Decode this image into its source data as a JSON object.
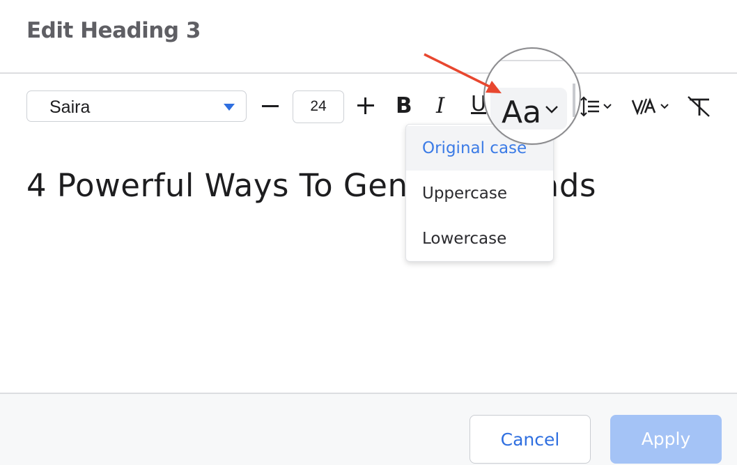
{
  "dialog": {
    "title": "Edit Heading 3"
  },
  "toolbar": {
    "font_family": "Saira",
    "font_size": "24",
    "bold_label": "B",
    "italic_label": "I",
    "underline_label": "U",
    "text_case_label": "Aa"
  },
  "editor": {
    "heading_text": "4 Powerful Ways To Generate Leads"
  },
  "case_menu": {
    "options": [
      {
        "label": "Original case",
        "selected": true
      },
      {
        "label": "Uppercase",
        "selected": false
      },
      {
        "label": "Lowercase",
        "selected": false
      }
    ]
  },
  "colors": {
    "accent": "#3b7be6",
    "apply_disabled": "#a4c3f6",
    "arrow": "#e8472f"
  },
  "buttons": {
    "cancel": "Cancel",
    "apply": "Apply"
  }
}
